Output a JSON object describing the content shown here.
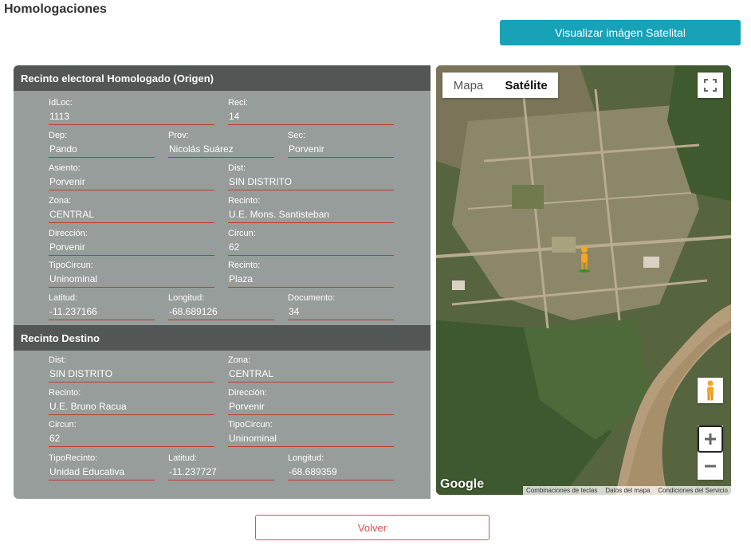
{
  "page": {
    "title": "Homologaciones"
  },
  "toolbar": {
    "satellite_button": "Visualizar imágen Satelital"
  },
  "origen": {
    "header": "Recinto electoral Homologado (Origen)",
    "fields": {
      "idloc": {
        "label": "IdLoc:",
        "value": "1113"
      },
      "reci": {
        "label": "Reci:",
        "value": "14"
      },
      "dep": {
        "label": "Dep:",
        "value": "Pando"
      },
      "prov": {
        "label": "Prov:",
        "value": "Nicolás Suárez"
      },
      "sec": {
        "label": "Sec:",
        "value": "Porvenir"
      },
      "asiento": {
        "label": "Asiento:",
        "value": "Porvenir"
      },
      "dist": {
        "label": "Dist:",
        "value": "SIN DISTRITO"
      },
      "zona": {
        "label": "Zona:",
        "value": "CENTRAL"
      },
      "recinto": {
        "label": "Recinto:",
        "value": "U.E. Mons. Santisteban"
      },
      "direccion": {
        "label": "Dirección:",
        "value": "Porvenir"
      },
      "circun": {
        "label": "Circun:",
        "value": "62"
      },
      "tipocircun": {
        "label": "TipoCircun:",
        "value": "Uninominal"
      },
      "recinto2": {
        "label": "Recinto:",
        "value": "Plaza"
      },
      "latitud": {
        "label": "Latitud:",
        "value": "-11.237166"
      },
      "longitud": {
        "label": "Longitud:",
        "value": "-68.689126"
      },
      "documento": {
        "label": "Documento:",
        "value": "34"
      }
    }
  },
  "destino": {
    "header": "Recinto Destino",
    "fields": {
      "dist": {
        "label": "Dist:",
        "value": "SIN DISTRITO"
      },
      "zona": {
        "label": "Zona:",
        "value": "CENTRAL"
      },
      "recinto": {
        "label": "Recinto:",
        "value": "U.E. Bruno Racua"
      },
      "direccion": {
        "label": "Dirección:",
        "value": "Porvenir"
      },
      "circun": {
        "label": "Circun:",
        "value": "62"
      },
      "tipocircun": {
        "label": "TipoCircun:",
        "value": "Uninominal"
      },
      "tiporecinto": {
        "label": "TipoRecinto:",
        "value": "Unidad Educativa"
      },
      "latitud": {
        "label": "Latitud:",
        "value": "-11.237727"
      },
      "longitud": {
        "label": "Longitud:",
        "value": "-68.689359"
      }
    }
  },
  "map": {
    "tabs": {
      "mapa": "Mapa",
      "satelite": "Satélite"
    },
    "active_tab": "Satélite",
    "logo": "Google",
    "footer": [
      "Combinaciones de teclas",
      "Datos del mapa",
      "Condiciones del Servicio"
    ],
    "icons": [
      "fullscreen-icon",
      "pegman-icon",
      "zoom-in-icon",
      "zoom-out-icon"
    ]
  },
  "footer": {
    "volver_button": "Volver"
  },
  "colors": {
    "accent": "#17a2b8",
    "danger": "#d9534f",
    "panel": "#979d9b",
    "header": "#525756",
    "underline": "#c0392b"
  }
}
